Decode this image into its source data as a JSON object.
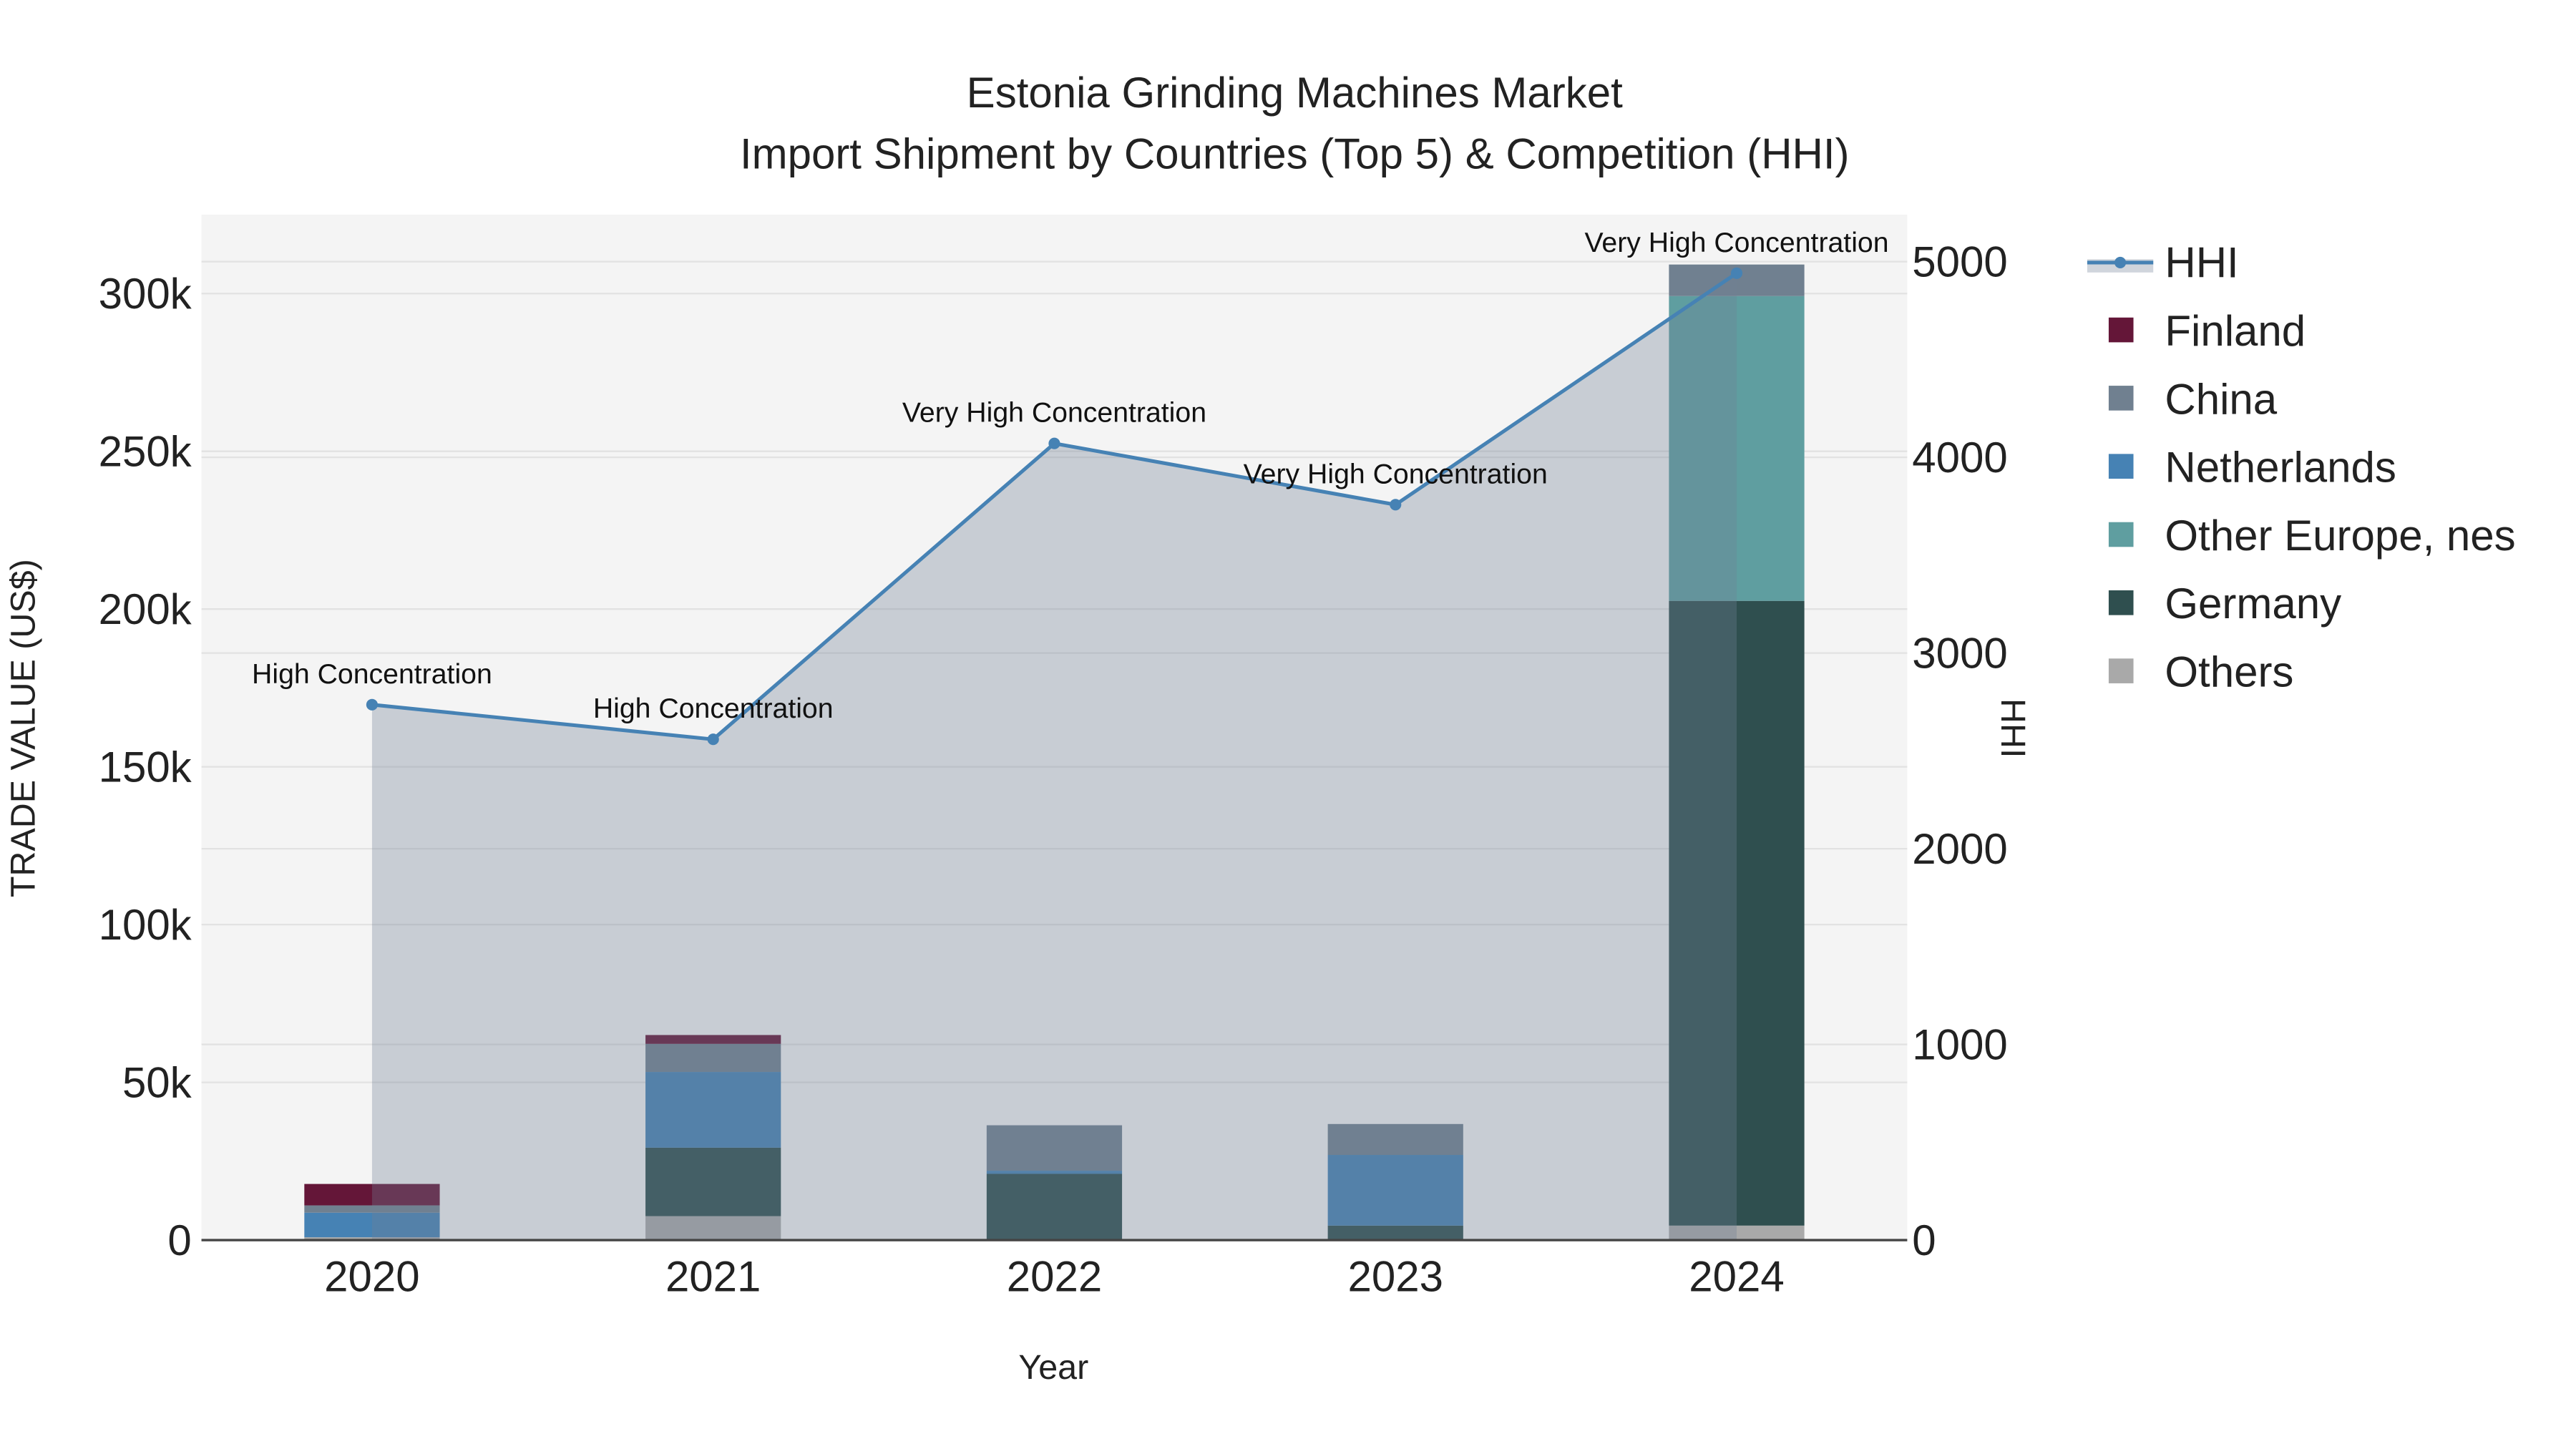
{
  "chart_data": {
    "type": "bar",
    "stacked": true,
    "title": "Estonia Grinding Machines Market",
    "subtitle": "Import Shipment by Countries (Top 5) & Competition (HHI)",
    "xlabel": "Year",
    "ylabel": "TRADE VALUE (US$)",
    "y2label": "HHI",
    "categories": [
      "2020",
      "2021",
      "2022",
      "2023",
      "2024"
    ],
    "ylim": [
      0,
      325000
    ],
    "y2lim": [
      0,
      5240
    ],
    "yticks": [
      0,
      50000,
      100000,
      150000,
      200000,
      250000,
      300000
    ],
    "ytick_labels": [
      "0",
      "50k",
      "100k",
      "150k",
      "200k",
      "250k",
      "300k"
    ],
    "y2ticks": [
      0,
      1000,
      2000,
      3000,
      4000,
      5000
    ],
    "y2tick_labels": [
      "0",
      "1000",
      "2000",
      "3000",
      "4000",
      "5000"
    ],
    "grid": true,
    "legend_position": "right",
    "series": [
      {
        "name": "Others",
        "color": "#A9A9A9",
        "values": [
          900,
          7600,
          0,
          0,
          4600
        ]
      },
      {
        "name": "Germany",
        "color": "#2F4F4F",
        "values": [
          0,
          21700,
          21000,
          4600,
          198000
        ]
      },
      {
        "name": "Other Europe, nes",
        "color": "#5F9EA0",
        "values": [
          0,
          0,
          0,
          0,
          96600
        ]
      },
      {
        "name": "Netherlands",
        "color": "#4682B4",
        "values": [
          7800,
          24000,
          1000,
          22400,
          0
        ]
      },
      {
        "name": "China",
        "color": "#708090",
        "values": [
          2300,
          8900,
          14400,
          9800,
          10000
        ]
      },
      {
        "name": "Finland",
        "color": "#641638",
        "values": [
          6800,
          2800,
          0,
          0,
          0
        ]
      }
    ],
    "hhi": {
      "name": "HHI",
      "color": "#4682B4",
      "values": [
        2736,
        2559,
        4071,
        3758,
        4941
      ],
      "labels": [
        "High Concentration",
        "High Concentration",
        "Very High Concentration",
        "Very High Concentration",
        "Very High Concentration"
      ]
    },
    "legend_order": [
      "HHI",
      "Finland",
      "China",
      "Netherlands",
      "Other Europe, nes",
      "Germany",
      "Others"
    ]
  }
}
